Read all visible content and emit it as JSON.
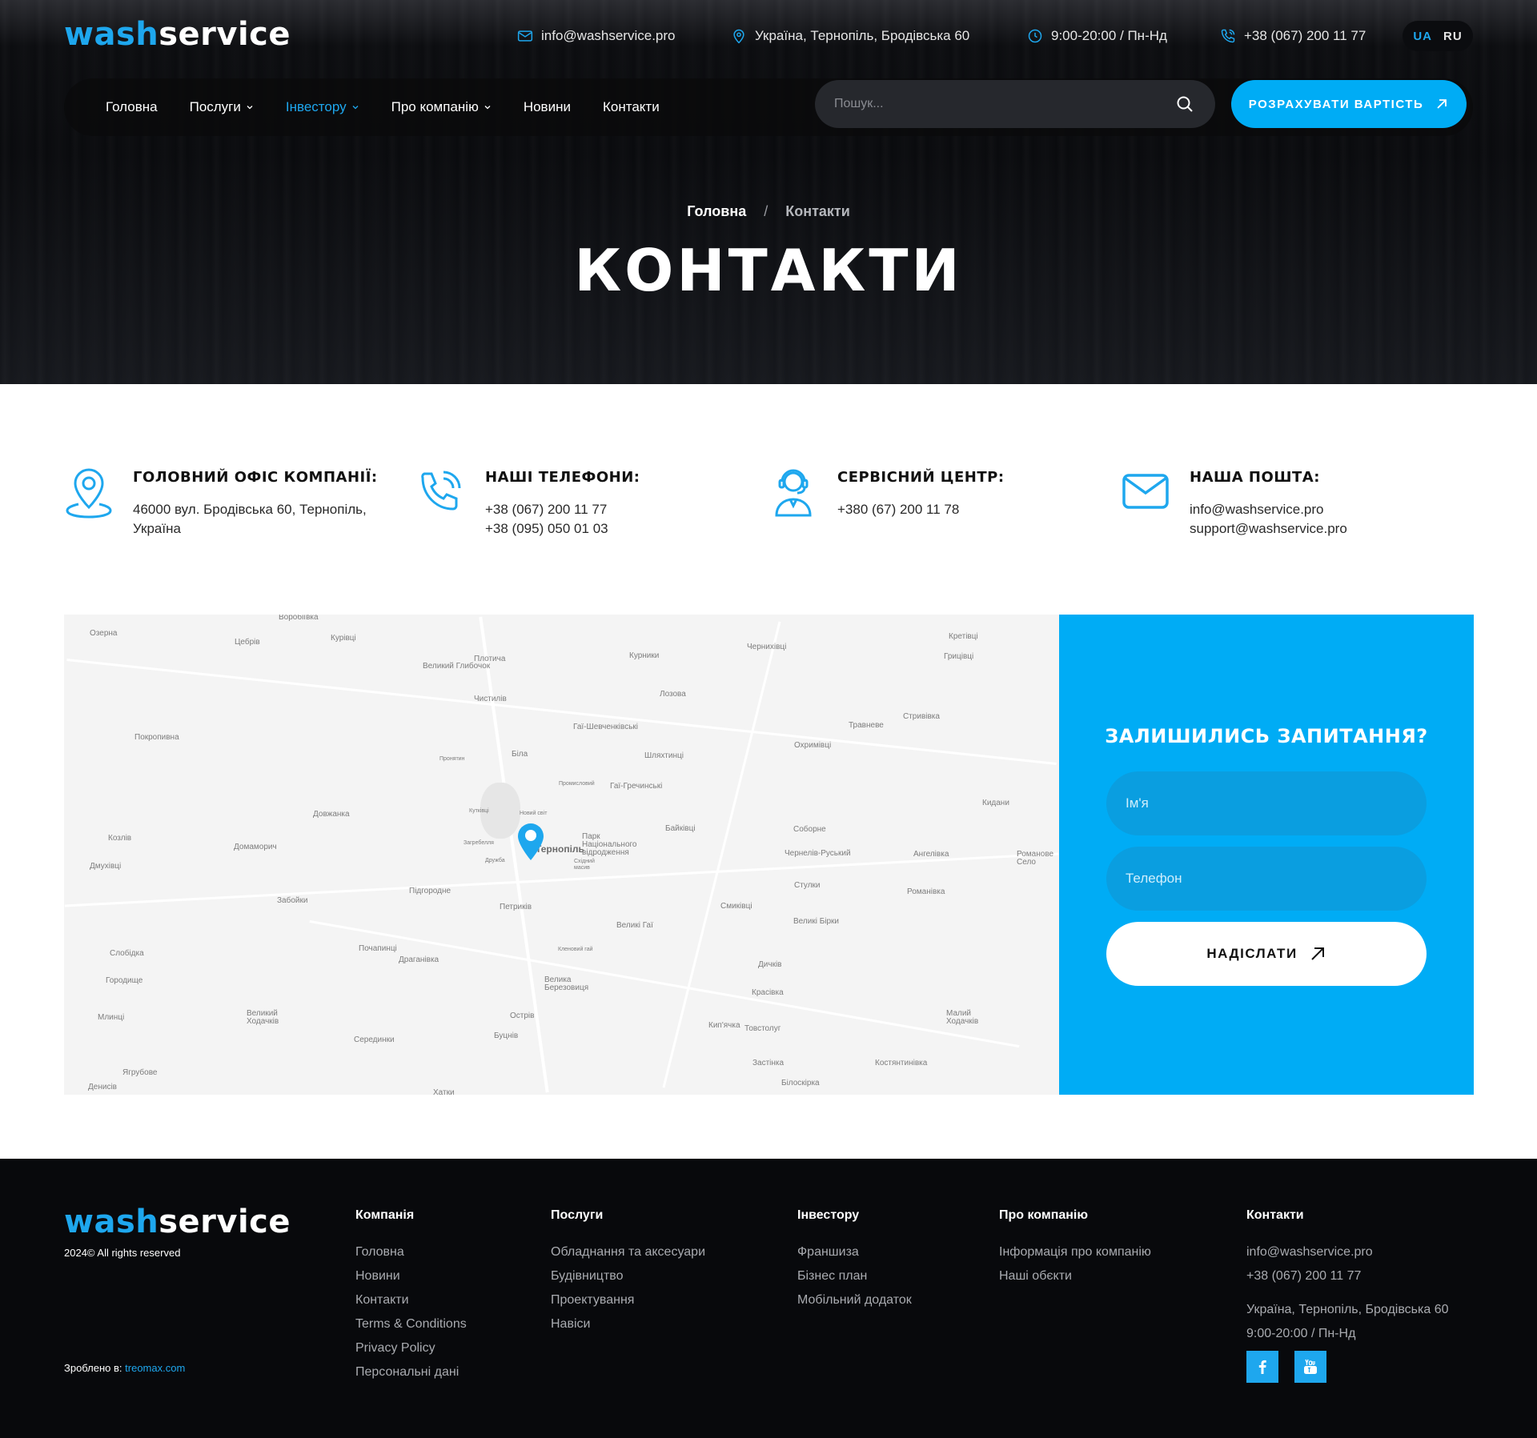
{
  "brand": {
    "part1": "wash",
    "part2": "service"
  },
  "colors": {
    "accent": "#00acf5",
    "dark": "#08090c"
  },
  "topbar": {
    "email": "info@washservice.pro",
    "address": "Україна, Тернопіль, Бродівська 60",
    "hours": "9:00-20:00 / Пн-Нд",
    "phone": "+38 (067) 200 11 77",
    "lang_ua": "UA",
    "lang_ru": "RU"
  },
  "nav": {
    "items": [
      {
        "label": "Головна"
      },
      {
        "label": "Послуги"
      },
      {
        "label": "Інвестору"
      },
      {
        "label": "Про компанію"
      },
      {
        "label": "Новини"
      },
      {
        "label": "Контакти"
      }
    ],
    "search_placeholder": "Пошук...",
    "cta": "Розрахувати вартість"
  },
  "hero": {
    "breadcrumb_home": "Головна",
    "breadcrumb_sep": "/",
    "breadcrumb_current": "Контакти",
    "title": "Контакти"
  },
  "info": {
    "office": {
      "title": "Головний офіс компанії:",
      "lines": [
        "46000 вул. Бродівська 60, Тернопіль,",
        "Україна"
      ]
    },
    "phones": {
      "title": "Наші телефони:",
      "lines": [
        "+38 (067) 200 11 77",
        "+38 (095) 050 01 03"
      ]
    },
    "service": {
      "title": "Сервісний центр:",
      "lines": [
        "+380 (67) 200 11 78"
      ]
    },
    "mail": {
      "title": "Наша пошта:",
      "lines": [
        "info@washservice.pro",
        "support@washservice.pro"
      ]
    }
  },
  "map": {
    "towns": [
      "Воробіївка",
      "Озерна",
      "Цебрів",
      "Курівці",
      "Плотича",
      "Великий Глибочок",
      "Курники",
      "Чернихівці",
      "Кретівці",
      "Грицівці",
      "Лозова",
      "Чистилів",
      "Гаї-Шевченківські",
      "Стривівка",
      "Травневе",
      "Покропивна",
      "Біла",
      "Шляхтинці",
      "Охримівці",
      "Пронятин",
      "Промисловий",
      "Гаї-Гречинські",
      "Довжанка",
      "Кутківці",
      "Новий світ",
      "Кидани",
      "Байківці",
      "Соборне",
      "Козлів",
      "Домаморич",
      "Загребелля",
      "Тернопіль",
      "Парк Національного відродження",
      "Чернелів-Руський",
      "Ангелівка",
      "Романове Село",
      "Дмухівці",
      "Дружба",
      "Східний масив",
      "Забойки",
      "Підгородне",
      "Петриків",
      "Смиківці",
      "Стулки",
      "Романівка",
      "Великі Бірки",
      "Великі Гаї",
      "Слобідка",
      "Почапинці",
      "Драганівка",
      "Кленовий гай",
      "Дичків",
      "Городище",
      "Велика Березовиця",
      "Красівка",
      "Млинці",
      "Великий Ходачків",
      "Острів",
      "Малий Ходачків",
      "Серединки",
      "Буцнів",
      "Кип'ячка",
      "Товстолуг",
      "Ягрубове",
      "Застінка",
      "Костянтинівка",
      "Денисів",
      "Білоскірка",
      "Хатки"
    ]
  },
  "form": {
    "title": "Залишились запитання?",
    "name_placeholder": "Ім'я",
    "phone_placeholder": "Телефон",
    "submit": "Надіслати"
  },
  "footer": {
    "copyright": "2024© All rights reserved",
    "made_by_label": "Зроблено в:",
    "made_by_link": "treomax.com",
    "columns": [
      {
        "title": "Компанія",
        "items": [
          "Головна",
          "Новини",
          "Контакти",
          "Terms & Conditions",
          "Privacy Policy",
          "Персональні дані"
        ]
      },
      {
        "title": "Послуги",
        "items": [
          "Обладнання та аксесуари",
          "Будівництво",
          "Проектування",
          "Навіси"
        ]
      },
      {
        "title": "Інвестору",
        "items": [
          "Франшиза",
          "Бізнес план",
          "Мобільний додаток"
        ]
      },
      {
        "title": "Про компанію",
        "items": [
          "Інформація про компанію",
          "Наші обєкти"
        ]
      },
      {
        "title": "Контакти",
        "items": [
          "info@washservice.pro",
          "+38 (067) 200 11 77",
          "Україна, Тернопіль, Бродівська 60",
          "9:00-20:00 / Пн-Нд"
        ]
      }
    ]
  }
}
